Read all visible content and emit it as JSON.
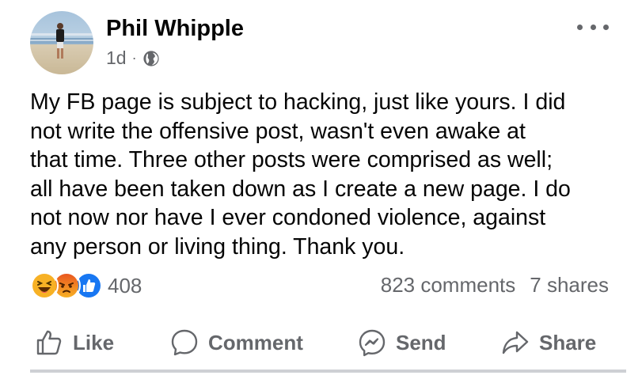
{
  "post": {
    "author": {
      "name": "Phil Whipple"
    },
    "meta": {
      "time": "1d",
      "separator": "·",
      "audience_icon": "globe-icon"
    },
    "text": "My FB page is subject to hacking, just like yours. I did\nnot write the offensive post, wasn't even awake at\nthat time. Three other posts were comprised as well;\nall have been taken down as I create a new page. I do\nnot now nor have I ever condoned violence, against\nany person or living thing. Thank you.",
    "reactions": {
      "icons": [
        "haha-icon",
        "angry-icon",
        "like-icon"
      ],
      "count": "408"
    },
    "comments": "823 comments",
    "shares": "7 shares",
    "actions": {
      "like": "Like",
      "comment": "Comment",
      "send": "Send",
      "share": "Share"
    }
  },
  "colors": {
    "secondary_text": "#65676b",
    "primary_text": "#050505",
    "like_blue": "#1877f2",
    "angry_red": "#e9710f",
    "haha_yellow": "#f7b125"
  }
}
